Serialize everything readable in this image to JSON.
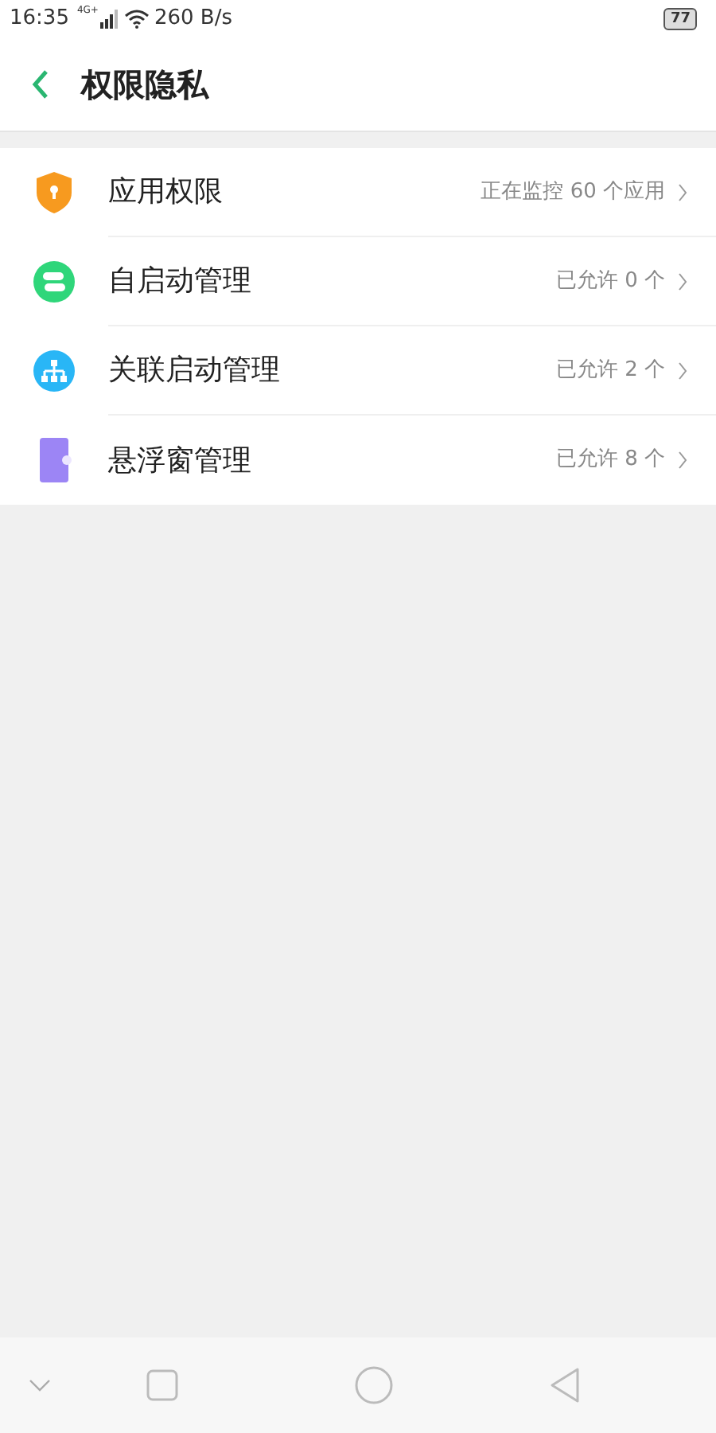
{
  "status_bar": {
    "time": "16:35",
    "network": "4G+",
    "speed": "260 B/s",
    "battery": "77"
  },
  "header": {
    "title": "权限隐私"
  },
  "items": [
    {
      "kind": "shield",
      "label": "应用权限",
      "value": "正在监控 60 个应用"
    },
    {
      "kind": "toggle",
      "label": "自启动管理",
      "value": "已允许 0 个"
    },
    {
      "kind": "tree",
      "label": "关联启动管理",
      "value": "已允许 2 个"
    },
    {
      "kind": "float",
      "label": "悬浮窗管理",
      "value": "已允许 8 个"
    }
  ]
}
